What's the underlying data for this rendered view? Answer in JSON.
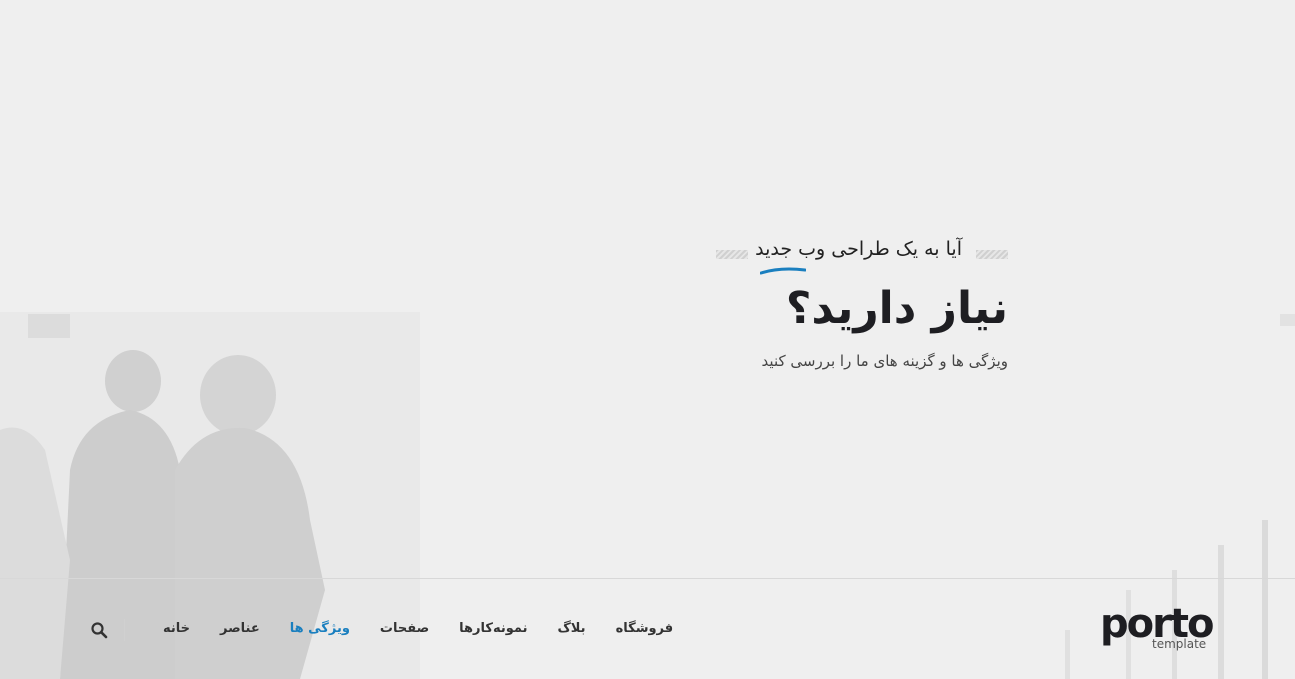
{
  "hero": {
    "subtitle": "آیا به یک طراحی وب جدید",
    "title": "نیاز دارید؟",
    "description": "ویژگی ها و گزینه های ما را بررسی کنید"
  },
  "nav": {
    "items": [
      {
        "label": "خانه",
        "active": false
      },
      {
        "label": "عناصر",
        "active": false
      },
      {
        "label": "ویژگی ها",
        "active": true
      },
      {
        "label": "صفحات",
        "active": false
      },
      {
        "label": "نمونه‌کارها",
        "active": false
      },
      {
        "label": "بلاگ",
        "active": false
      },
      {
        "label": "فروشگاه",
        "active": false
      }
    ]
  },
  "logo": {
    "word": "porto",
    "sub": "template"
  },
  "colors": {
    "accent": "#1a7fbf",
    "text_dark": "#1e1e22",
    "background": "#efefef"
  },
  "icons": {
    "search": "search-icon"
  }
}
